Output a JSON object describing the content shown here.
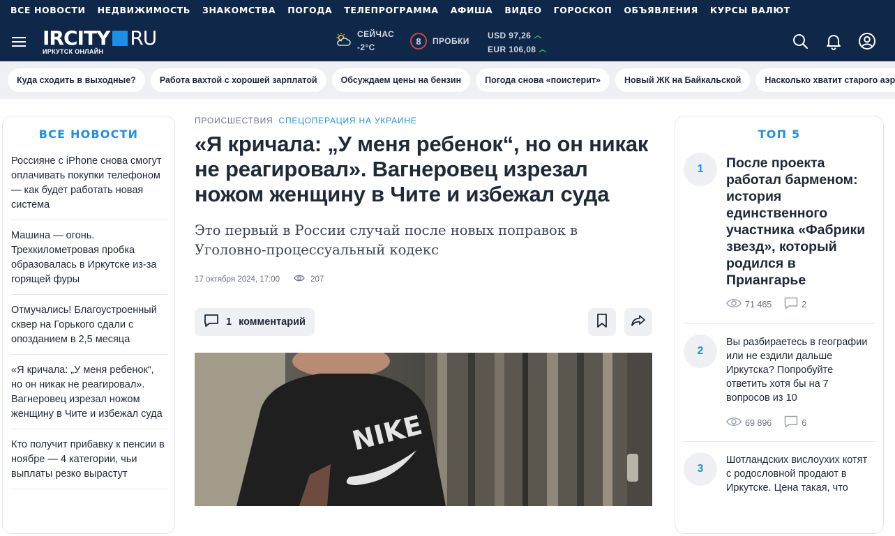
{
  "topnav": [
    "ВСЕ НОВОСТИ",
    "НЕДВИЖИМОСТЬ",
    "ЗНАКОМСТВА",
    "ПОГОДА",
    "ТЕЛЕПРОГРАММА",
    "АФИША",
    "ВИДЕО",
    "ГОРОСКОП",
    "ОБЪЯВЛЕНИЯ",
    "КУРСЫ ВАЛЮТ"
  ],
  "header": {
    "logo_main": "IRCITY",
    "logo_ru": "RU",
    "logo_sub": "ИРКУТСК ОНЛАЙН",
    "weather_label": "СЕЙЧАС",
    "weather_temp": "-2°C",
    "traffic_level": "8",
    "traffic_label": "ПРОБКИ",
    "usd": "USD 97,26",
    "eur": "EUR 106,08",
    "icons": [
      "search-icon",
      "bell-icon",
      "user-icon"
    ]
  },
  "tags": [
    "Куда сходить в выходные?",
    "Работа вахтой с хорошей зарплатой",
    "Обсуждаем цены на бензин",
    "Погода снова «поистерит»",
    "Новый ЖК на Байкальской",
    "Насколько хватит старого аэропорта"
  ],
  "left": {
    "title": "ВСЕ НОВОСТИ",
    "items": [
      "Россияне с iPhone снова смогут оплачивать покупки телефоном — как будет работать новая система",
      "Машина — огонь. Трехкилометровая пробка образовалась в Иркутске из-за горящей фуры",
      "Отмучались! Благоустроенный сквер на Горького сдали с опозданием в 2,5 месяца",
      "«Я кричала: „У меня ребенок“, но он никак не реагировал». Вагнеровец изрезал ножом женщину в Чите и избежал суда",
      "Кто получит прибавку к пенсии в ноябре — 4 категории, чьи выплаты резко вырастут"
    ]
  },
  "article": {
    "category": "ПРОИСШЕСТВИЯ",
    "subcategory": "СПЕЦОПЕРАЦИЯ НА УКРАИНЕ",
    "headline": "«Я кричала: „У меня ребенок“, но он никак не реагировал». Вагнеровец изрезал ножом женщину в Чите и избежал суда",
    "lead": "Это первый в России случай после новых поправок в Уголовно-процессуальный кодекс",
    "date": "17 октября 2024, 17:00",
    "views": "207",
    "comments_count": "1",
    "comments_label": "комментарий",
    "photo_shirt_text": "NIKE"
  },
  "right": {
    "title": "ТОП 5",
    "items": [
      {
        "num": "1",
        "title": "После проекта работал барменом: история единственного участника «Фабрики звезд», который родился в Приангарье",
        "views": "71 465",
        "comments": "2"
      },
      {
        "num": "2",
        "title": "Вы разбираетесь в географии или не ездили дальше Иркутска? Попробуйте ответить хотя бы на 7 вопросов из 10",
        "views": "69 896",
        "comments": "6"
      },
      {
        "num": "3",
        "title": "Шотландских вислоухих котят с родословной продают в Иркутске. Цена такая, что",
        "views": "",
        "comments": ""
      }
    ]
  }
}
